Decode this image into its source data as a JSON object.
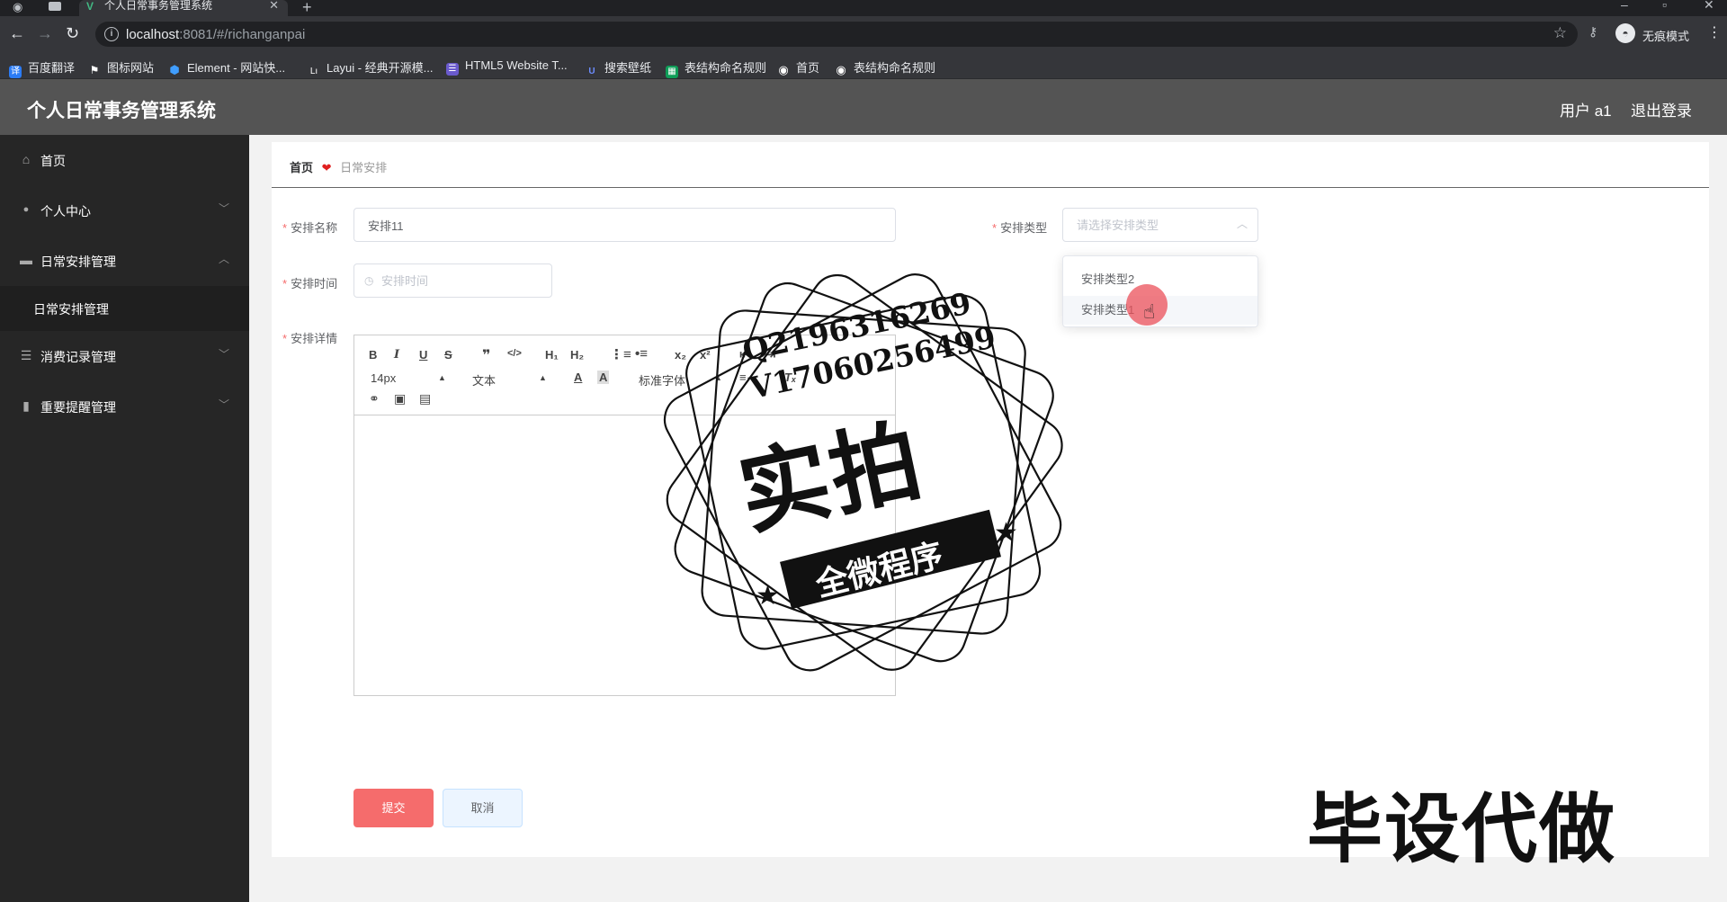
{
  "browser": {
    "tab_title": "个人日常事务管理系统",
    "url_host": "localhost",
    "url_rest": ":8081/#/richanganpai",
    "mode_label": "无痕模式",
    "bookmarks": [
      {
        "label": "百度翻译",
        "color": "#2b7cf6",
        "icon": "译"
      },
      {
        "label": "图标网站",
        "color": "#202124",
        "icon": "⚑"
      },
      {
        "label": "Element - 网站快...",
        "color": "#409eff",
        "icon": "⬢"
      },
      {
        "label": "Layui - 经典开源模...",
        "color": "#202124",
        "icon": "Lı"
      },
      {
        "label": "HTML5 Website T...",
        "color": "#6a5acd",
        "icon": "☰"
      },
      {
        "label": "搜索壁纸",
        "color": "#3b5bdb",
        "icon": "U"
      },
      {
        "label": "表结构命名规则",
        "color": "#0f9d58",
        "icon": "▦"
      },
      {
        "label": "首页",
        "color": "#202124",
        "icon": "◉"
      },
      {
        "label": "表结构命名规则",
        "color": "#202124",
        "icon": "◉"
      }
    ]
  },
  "header": {
    "title": "个人日常事务管理系统",
    "user": "用户 a1",
    "logout": "退出登录"
  },
  "sidebar": {
    "items": [
      {
        "label": "首页",
        "icon": "home-icon",
        "glyph": "⌂"
      },
      {
        "label": "个人中心",
        "icon": "user-icon",
        "glyph": "●"
      },
      {
        "label": "日常安排管理",
        "icon": "flag-icon",
        "glyph": "▬"
      },
      {
        "label": "消费记录管理",
        "icon": "list-icon",
        "glyph": "☰"
      },
      {
        "label": "重要提醒管理",
        "icon": "bell-icon",
        "glyph": "▮"
      }
    ],
    "submenu": {
      "label": "日常安排管理"
    }
  },
  "breadcrumb": {
    "home": "首页",
    "current": "日常安排"
  },
  "form": {
    "name_label": "安排名称",
    "name_value": "安排11",
    "type_label": "安排类型",
    "type_placeholder": "请选择安排类型",
    "time_label": "安排时间",
    "time_placeholder": "安排时间",
    "detail_label": "安排详情",
    "type_options": [
      "安排类型2",
      "安排类型1"
    ]
  },
  "editor": {
    "size": "14px",
    "header": "文本",
    "font": "标准字体"
  },
  "buttons": {
    "submit": "提交",
    "cancel": "取消"
  },
  "watermark": {
    "line1": "Q2196316269",
    "line2": "V17060256499",
    "big": "实拍",
    "banner": "全微程序",
    "bottom": "毕设代做"
  },
  "colors": {
    "header_bg": "#545454",
    "sidebar_bg": "#262626",
    "primary": "#f56c6c",
    "required": "#f56c6c"
  }
}
